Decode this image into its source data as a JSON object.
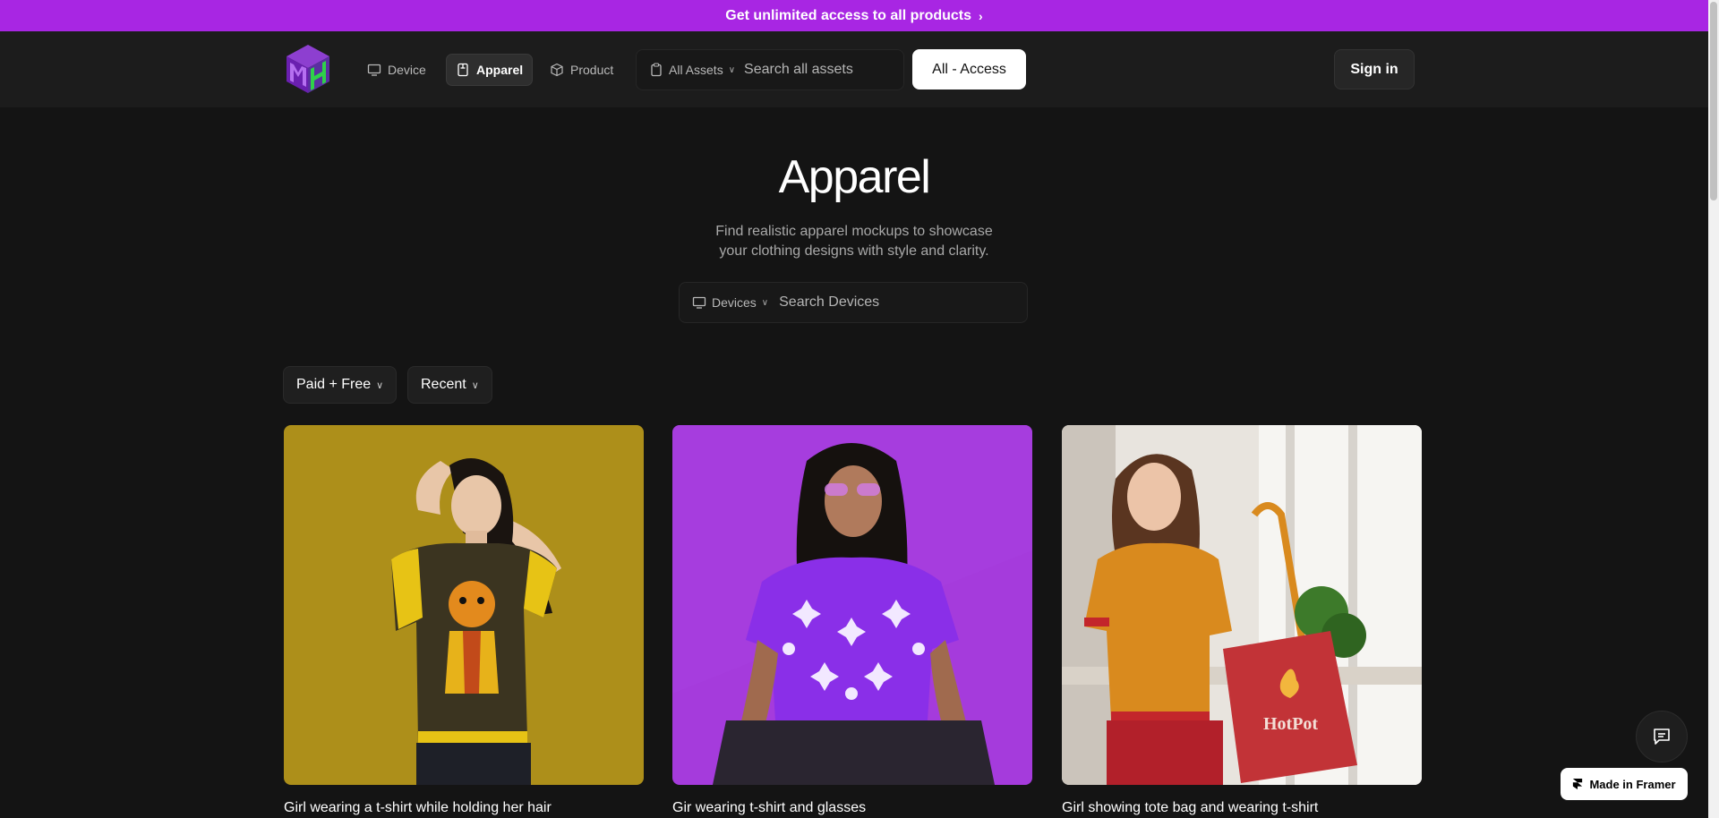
{
  "promo": {
    "text": "Get unlimited access to all products",
    "color": "#a826e3"
  },
  "nav": {
    "items": [
      {
        "label": "Device",
        "icon": "monitor-icon"
      },
      {
        "label": "Apparel",
        "icon": "shirt-tag-icon",
        "active": true
      },
      {
        "label": "Product",
        "icon": "box-icon"
      }
    ],
    "asset_category": "All Assets",
    "search_placeholder": "Search all assets",
    "access_label": "All - Access",
    "signin_label": "Sign in"
  },
  "hero": {
    "title": "Apparel",
    "subtitle_line1": "Find realistic apparel mockups to showcase",
    "subtitle_line2": "your clothing designs with style and clarity.",
    "search_category": "Devices",
    "search_placeholder": "Search Devices"
  },
  "filters": {
    "pricing": "Paid + Free",
    "sort": "Recent"
  },
  "cards": [
    {
      "title": "Girl wearing a t-shirt while holding her hair",
      "bg": "#ad8f1a"
    },
    {
      "title": "Gir wearing t-shirt and glasses",
      "bg": "#a53bdc"
    },
    {
      "title": "Girl showing tote bag and wearing t-shirt",
      "bg": "#e8e4de"
    }
  ],
  "framer_badge": "Made in Framer"
}
